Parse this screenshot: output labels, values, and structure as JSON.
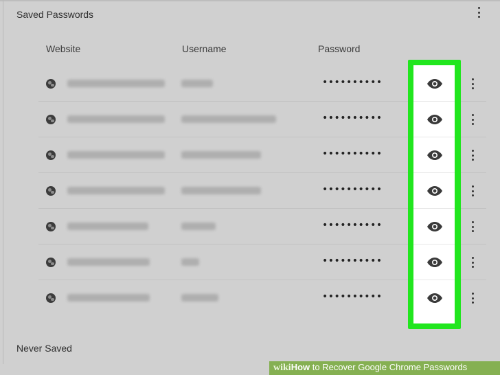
{
  "saved_passwords": {
    "title": "Saved Passwords",
    "columns": {
      "website": "Website",
      "username": "Username",
      "password": "Password"
    },
    "rows": [
      {
        "password": "••••••••••"
      },
      {
        "password": "••••••••••"
      },
      {
        "password": "••••••••••"
      },
      {
        "password": "••••••••••"
      },
      {
        "password": "••••••••••"
      },
      {
        "password": "••••••••••"
      },
      {
        "password": "••••••••••"
      }
    ],
    "row_icon": "globe-icon",
    "reveal_icon": "eye-icon",
    "more_icon": "more-vert-icon"
  },
  "never_saved": {
    "title": "Never Saved"
  },
  "highlight_color": "#21e61e",
  "banner": {
    "brand": "wiki",
    "how": "How",
    "rest": " to Recover Google Chrome Passwords",
    "color": "#78aa3c"
  }
}
